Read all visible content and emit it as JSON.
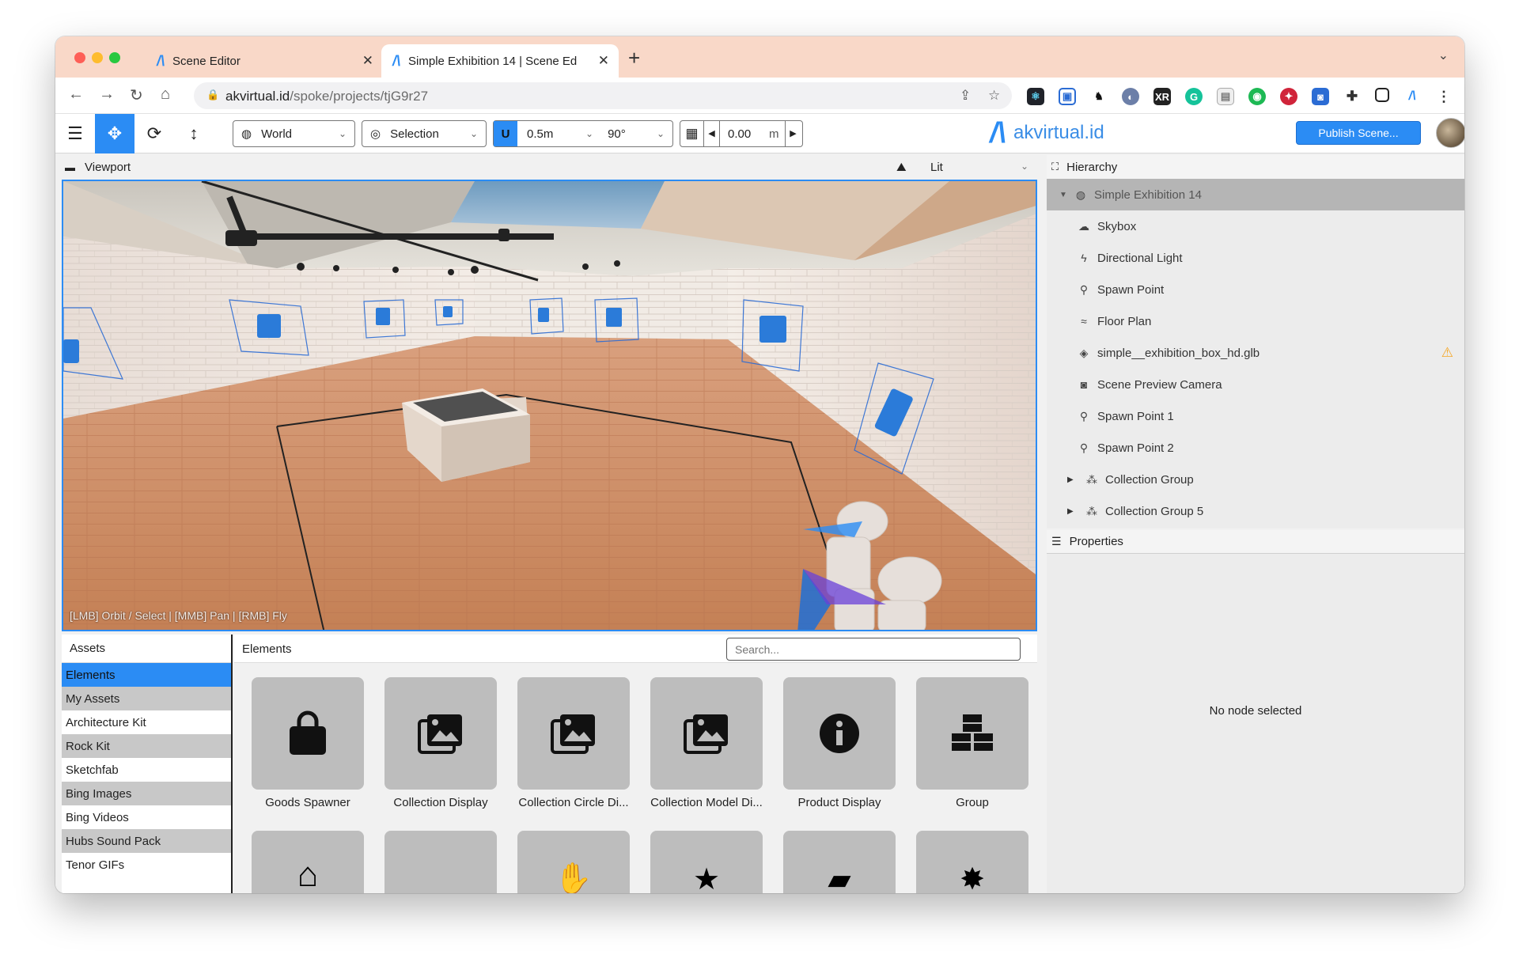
{
  "browser": {
    "tabs": [
      {
        "title": "Scene Editor"
      },
      {
        "title": "Simple Exhibition 14 | Scene Ed"
      }
    ],
    "url_host": "akvirtual.id",
    "url_path": "/spoke/projects/tjG9r27"
  },
  "toolbar": {
    "space_select": "World",
    "pivot_select": "Selection",
    "snap_translate": "0.5m",
    "snap_rotate": "90°",
    "grid_height": "0.00",
    "grid_unit": "m",
    "brand": "akvirtual.id",
    "publish_label": "Publish Scene..."
  },
  "viewport": {
    "title": "Viewport",
    "render_mode": "Lit",
    "hint": "[LMB] Orbit / Select | [MMB] Pan | [RMB] Fly"
  },
  "assets": {
    "title": "Assets",
    "sources": [
      "Elements",
      "My Assets",
      "Architecture Kit",
      "Rock Kit",
      "Sketchfab",
      "Bing Images",
      "Bing Videos",
      "Hubs Sound Pack",
      "Tenor GIFs"
    ],
    "selected": "Elements",
    "panel_title": "Elements",
    "search_placeholder": "Search...",
    "elements": [
      {
        "label": "Goods Spawner",
        "icon": "shopping-bag-icon"
      },
      {
        "label": "Collection Display",
        "icon": "images-icon"
      },
      {
        "label": "Collection Circle Di...",
        "icon": "images-icon"
      },
      {
        "label": "Collection Model Di...",
        "icon": "images-icon"
      },
      {
        "label": "Product Display",
        "icon": "info-icon"
      },
      {
        "label": "Group",
        "icon": "cubes-icon"
      }
    ]
  },
  "hierarchy": {
    "title": "Hierarchy",
    "nodes": [
      {
        "label": "Simple Exhibition 14",
        "icon": "globe-icon"
      },
      {
        "label": "Skybox",
        "icon": "cloud-icon"
      },
      {
        "label": "Directional Light",
        "icon": "bolt-icon"
      },
      {
        "label": "Spawn Point",
        "icon": "street-view-icon"
      },
      {
        "label": "Floor Plan",
        "icon": "shoe-prints-icon"
      },
      {
        "label": "simple__exhibition_box_hd.glb",
        "icon": "cube-icon"
      },
      {
        "label": "Scene Preview Camera",
        "icon": "camera-icon"
      },
      {
        "label": "Spawn Point 1",
        "icon": "street-view-icon"
      },
      {
        "label": "Spawn Point 2",
        "icon": "street-view-icon"
      },
      {
        "label": "Collection Group",
        "icon": "cubes-icon"
      },
      {
        "label": "Collection Group 5",
        "icon": "cubes-icon"
      }
    ]
  },
  "properties": {
    "title": "Properties",
    "empty_text": "No node selected"
  },
  "colors": {
    "accent": "#2b8cf4",
    "tabstrip": "#f9d8c8",
    "warning": "#f5a623"
  }
}
